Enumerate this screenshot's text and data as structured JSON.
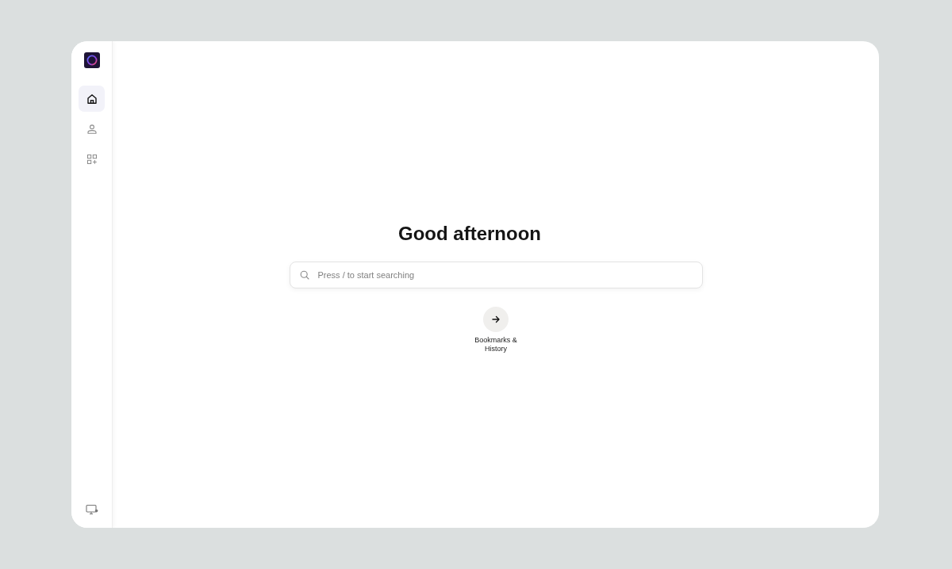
{
  "sidebar": {
    "nav_items": [
      {
        "kind": "home",
        "selected": true
      },
      {
        "kind": "profile",
        "selected": false
      },
      {
        "kind": "apps",
        "selected": false
      }
    ]
  },
  "main": {
    "greeting": "Good afternoon",
    "search": {
      "placeholder": "Press / to start searching"
    },
    "shortcuts": [
      {
        "kind": "arrow",
        "label": "Bookmarks & History"
      }
    ]
  }
}
